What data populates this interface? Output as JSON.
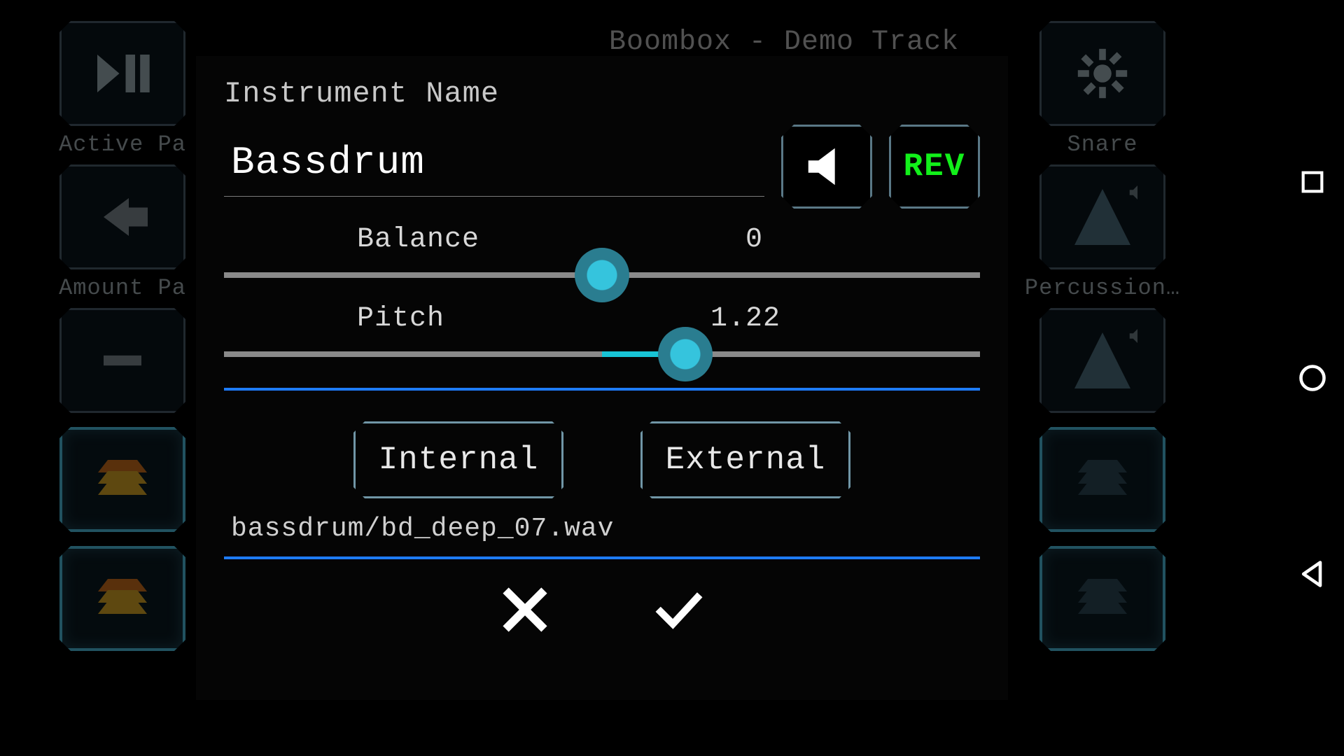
{
  "header": {
    "track_title": "Boombox - Demo Track"
  },
  "bg_left": {
    "row0_label": "Active Pa",
    "row1_label": "Amount Pa"
  },
  "bg_right": {
    "row0_label": "Snare",
    "row1_label": "Percussion…"
  },
  "modal": {
    "title": "Instrument Name",
    "name_value": "Bassdrum",
    "rev_label": "REV",
    "balance_label": "Balance",
    "balance_value": "0",
    "balance_pct": 50,
    "pitch_label": "Pitch",
    "pitch_value": "1.22",
    "pitch_pct": 61,
    "source_internal": "Internal",
    "source_external": "External",
    "file_path": "bassdrum/bd_deep_07.wav"
  }
}
